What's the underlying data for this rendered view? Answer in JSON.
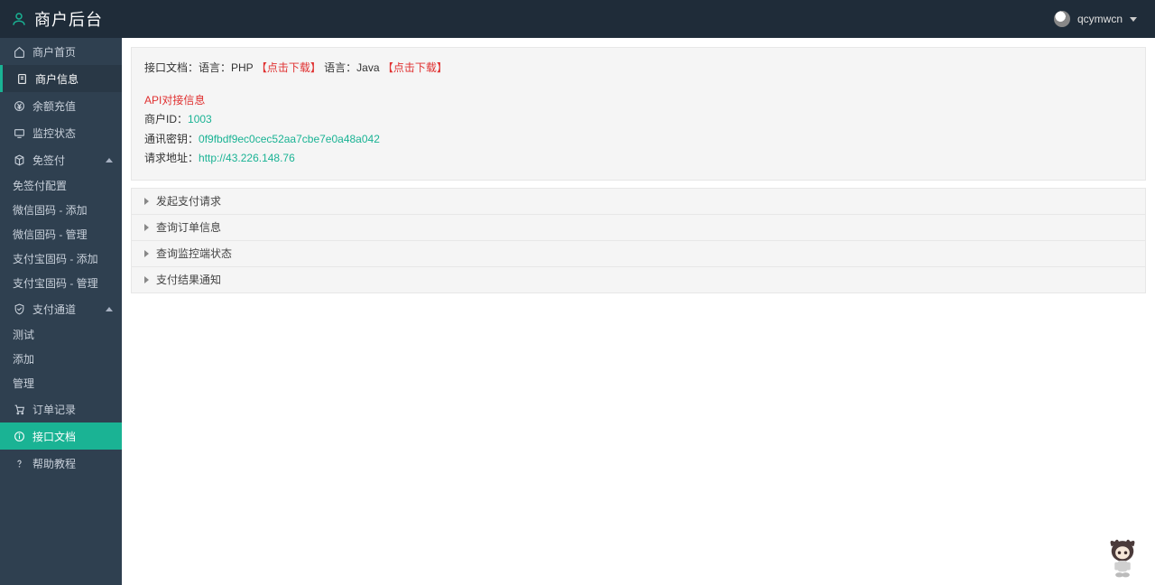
{
  "header": {
    "title": "商户后台",
    "username": "qcymwcn"
  },
  "sidebar": {
    "home": "商户首页",
    "info": "商户信息",
    "recharge": "余额充值",
    "monitor": "监控状态",
    "mianqian": "免签付",
    "mq_items": [
      "免签付配置",
      "微信固码 - 添加",
      "微信固码 - 管理",
      "支付宝固码 - 添加",
      "支付宝固码 - 管理"
    ],
    "channel": "支付通道",
    "ch_items": [
      "测试",
      "添加",
      "管理"
    ],
    "orders": "订单记录",
    "apidoc": "接口文档",
    "help": "帮助教程"
  },
  "info": {
    "doc_prefix": "接口文档：语言：PHP",
    "download1": "【点击下载】",
    "doc_mid": "语言：Java",
    "download2": "【点击下载】",
    "api_title": "API对接信息",
    "merchant_label": "商户ID：",
    "merchant_id": "1003",
    "secret_label": "通讯密钥：",
    "secret": "0f9fbdf9ec0cec52aa7cbe7e0a48a042",
    "url_label": "请求地址：",
    "url": "http://43.226.148.76"
  },
  "accordion": [
    "发起支付请求",
    "查询订单信息",
    "查询监控端状态",
    "支付结果通知"
  ]
}
